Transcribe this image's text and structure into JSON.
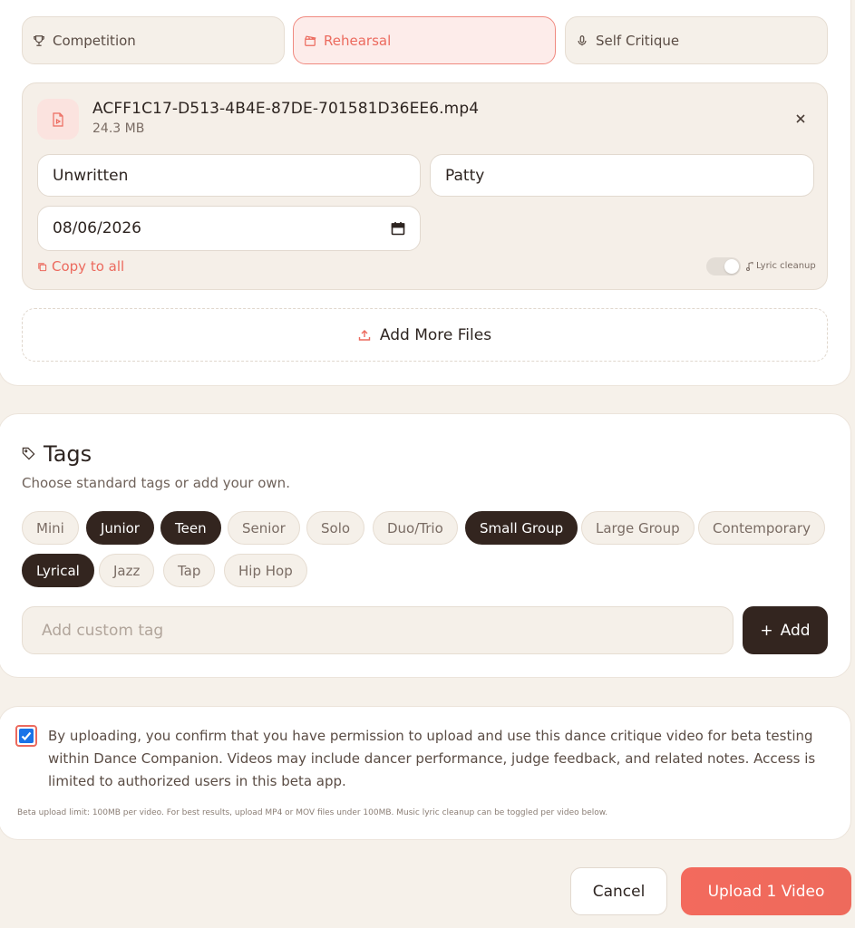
{
  "session_types": [
    {
      "label": "Competition",
      "icon": "trophy-icon",
      "active": false
    },
    {
      "label": "Rehearsal",
      "icon": "clapperboard-icon",
      "active": true
    },
    {
      "label": "Self Critique",
      "icon": "microphone-icon",
      "active": false
    }
  ],
  "file": {
    "name": "ACFF1C17-D513-4B4E-87DE-701581D36EE6.mp4",
    "size": "24.3 MB",
    "routine_value": "Unwritten",
    "dancer_value": "Patty",
    "date_value": "08/06/2026",
    "copy_label": "Copy to all",
    "lyric_cleanup_label": "Lyric cleanup",
    "lyric_cleanup_on": true
  },
  "add_more_label": "Add More Files",
  "tags": {
    "title": "Tags",
    "subtitle": "Choose standard tags or add your own.",
    "items": [
      {
        "label": "Mini",
        "selected": false
      },
      {
        "label": "Junior",
        "selected": true
      },
      {
        "label": "Teen",
        "selected": true
      },
      {
        "label": "Senior",
        "selected": false
      },
      {
        "label": "Solo",
        "selected": false
      },
      {
        "label": "Duo/Trio",
        "selected": false
      },
      {
        "label": "Small Group",
        "selected": true
      },
      {
        "label": "Large Group",
        "selected": false
      },
      {
        "label": "Contemporary",
        "selected": false
      },
      {
        "label": "Lyrical",
        "selected": true
      },
      {
        "label": "Jazz",
        "selected": false
      },
      {
        "label": "Tap",
        "selected": false
      },
      {
        "label": "Hip Hop",
        "selected": false
      }
    ],
    "custom_placeholder": "Add custom tag",
    "add_label": "Add"
  },
  "consent": {
    "checked": true,
    "text": "By uploading, you confirm that you have permission to upload and use this dance critique video for beta testing within Dance Companion. Videos may include dancer performance, judge feedback, and related notes. Access is limited to authorized users in this beta app.",
    "note": "Beta upload limit: 100MB per video. For best results, upload MP4 or MOV files under 100MB. Music lyric cleanup can be toggled per video below."
  },
  "actions": {
    "cancel": "Cancel",
    "upload": "Upload 1 Video"
  },
  "colors": {
    "accent": "#ec6a5e",
    "dark": "#33251f",
    "background": "#f6f1ea"
  }
}
